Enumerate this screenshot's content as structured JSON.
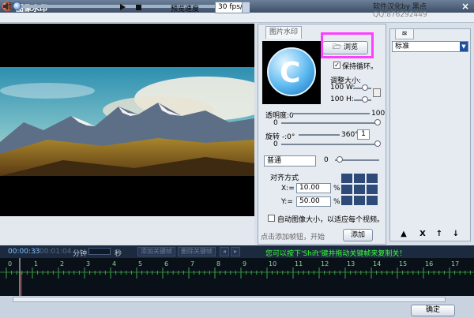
{
  "window": {
    "title": "图像水印",
    "close": "×"
  },
  "menu": {
    "preview": "预览"
  },
  "credit": {
    "text": "软件汉化by 黑点",
    "qq": "QQ:876292449"
  },
  "player": {
    "speed_label": "预览速度",
    "speed_value": "30 fps/s"
  },
  "watermark": {
    "tab": "图片水印",
    "browse_label": "浏览",
    "loop_label": "保持循环。",
    "resize_label": "调整大小:",
    "width_label": "100  W:",
    "height_label": "100  H:",
    "opacity_label": "透明度:0",
    "opacity_value": "0",
    "opacity_max": "100",
    "rotate_label": "旋转 -:0°",
    "rotate_min": "0",
    "rotate_max": "360°  x",
    "rotate_step": "1",
    "blend_mode": "普通",
    "blend_value": "0",
    "align_label": "对齐方式",
    "x_label": "X:=",
    "x_value": "10.00",
    "x_unit": "%",
    "y_label": "Y:=",
    "y_value": "50.00",
    "y_unit": "%",
    "auto_size_label": "自动图像大小，以适应每个视频。",
    "add_hint": "点击添加帧钮，开始",
    "add_label": "添加"
  },
  "presets": {
    "tab_icon": "layers-icon",
    "selected": "标准",
    "tools": [
      "lock-icon",
      "delete-icon",
      "up-arrow-icon",
      "down-arrow-icon"
    ],
    "tool_glyphs": [
      "▲",
      "X",
      "↑",
      "↓"
    ]
  },
  "timeline": {
    "current": "00:00:33",
    "separator": "/",
    "total": "00:01:04",
    "minute_label": "分钟",
    "second_label": "秒",
    "add_keyframe": "添加关键帧",
    "delete_keyframe": "删除关键帧",
    "hint": "您可以按下'Shift'键并拖动关键帧来复制关！",
    "ticks": [
      "0",
      "1",
      "2",
      "3",
      "4",
      "5",
      "6",
      "7",
      "8",
      "9",
      "10",
      "11",
      "12",
      "13",
      "14",
      "15",
      "16",
      "17"
    ]
  },
  "ok_label": "确定",
  "colors": {
    "accent": "#1e4e9c",
    "highlight": "#ff3fff",
    "hint_green": "#3cff3c"
  }
}
